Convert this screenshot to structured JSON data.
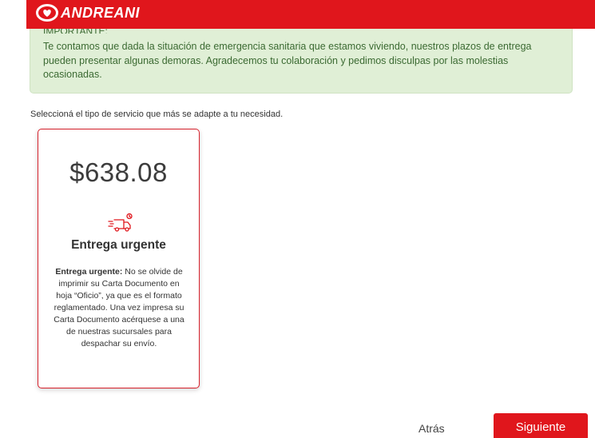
{
  "brand": {
    "name": "ANDREANI"
  },
  "colors": {
    "brand_red": "#e0161c",
    "alert_bg": "#e0efd6",
    "alert_text": "#3b6a32"
  },
  "alert": {
    "heading": "IMPORTANTE:",
    "message": "Te contamos que dada la situación de emergencia sanitaria que estamos viviendo, nuestros plazos de entrega pueden presentar algunas demoras. Agradecemos tu colaboración y pedimos disculpas por las molestias ocasionadas."
  },
  "instructions": "Seleccioná el tipo de servicio que más se adapte a tu necesidad.",
  "service_card": {
    "currency": "$",
    "amount": "638.08",
    "icon": "fast-delivery-truck-icon",
    "title": "Entrega urgente",
    "description_label": "Entrega urgente:",
    "description_text": " No se olvide de imprimir su Carta Documento en hoja “Oficio”, ya que es el formato reglamentado. Una vez impresa su Carta Documento acérquese a una de nuestras sucursales para despachar su envío."
  },
  "actions": {
    "back_label": "Atrás",
    "next_label": "Siguiente"
  }
}
